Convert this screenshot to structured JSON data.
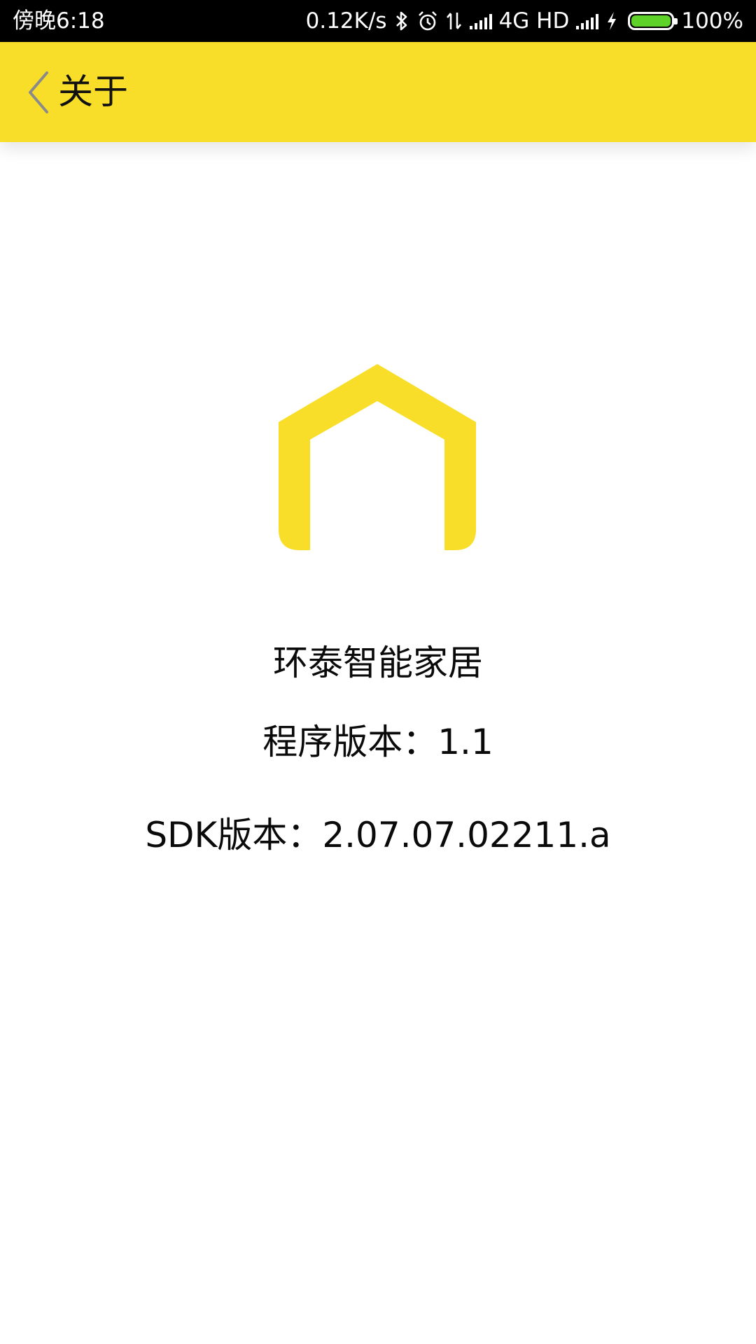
{
  "status_bar": {
    "time": "傍晚6:18",
    "net_speed": "0.12K/s",
    "network_type": "4G HD",
    "battery_percent": "100%",
    "battery_level": 1.0,
    "icons": [
      "bluetooth-icon",
      "alarm-icon",
      "data-transfer-icon",
      "signal-icon",
      "signal-icon-2",
      "charging-icon",
      "battery-icon"
    ]
  },
  "app_bar": {
    "title": "关于",
    "back_icon": "chevron-left-icon",
    "color": "#F8DE29"
  },
  "content": {
    "logo_icon": "house-logo-icon",
    "logo_color": "#F8DE29",
    "app_name": "环泰智能家居",
    "app_version": "程序版本：1.1",
    "sdk_version": "SDK版本：2.07.07.02211.a"
  },
  "colors": {
    "accent": "#F8DE29",
    "battery_fill": "#5FD22A"
  }
}
